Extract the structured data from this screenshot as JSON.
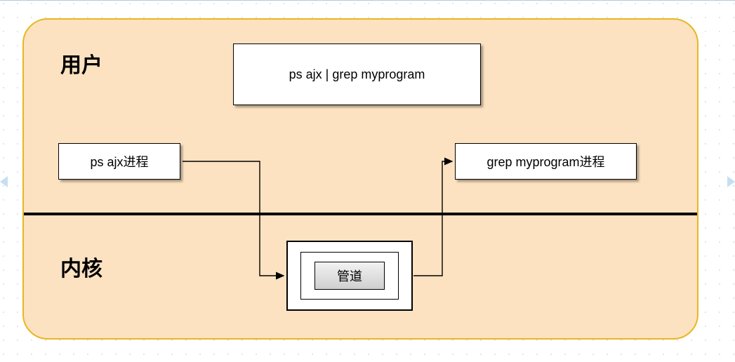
{
  "labels": {
    "user": "用户",
    "kernel": "内核"
  },
  "boxes": {
    "command": "ps  ajx | grep myprogram",
    "ps_process": "ps  ajx进程",
    "grep_process": "grep myprogram进程",
    "pipe": "管道"
  }
}
